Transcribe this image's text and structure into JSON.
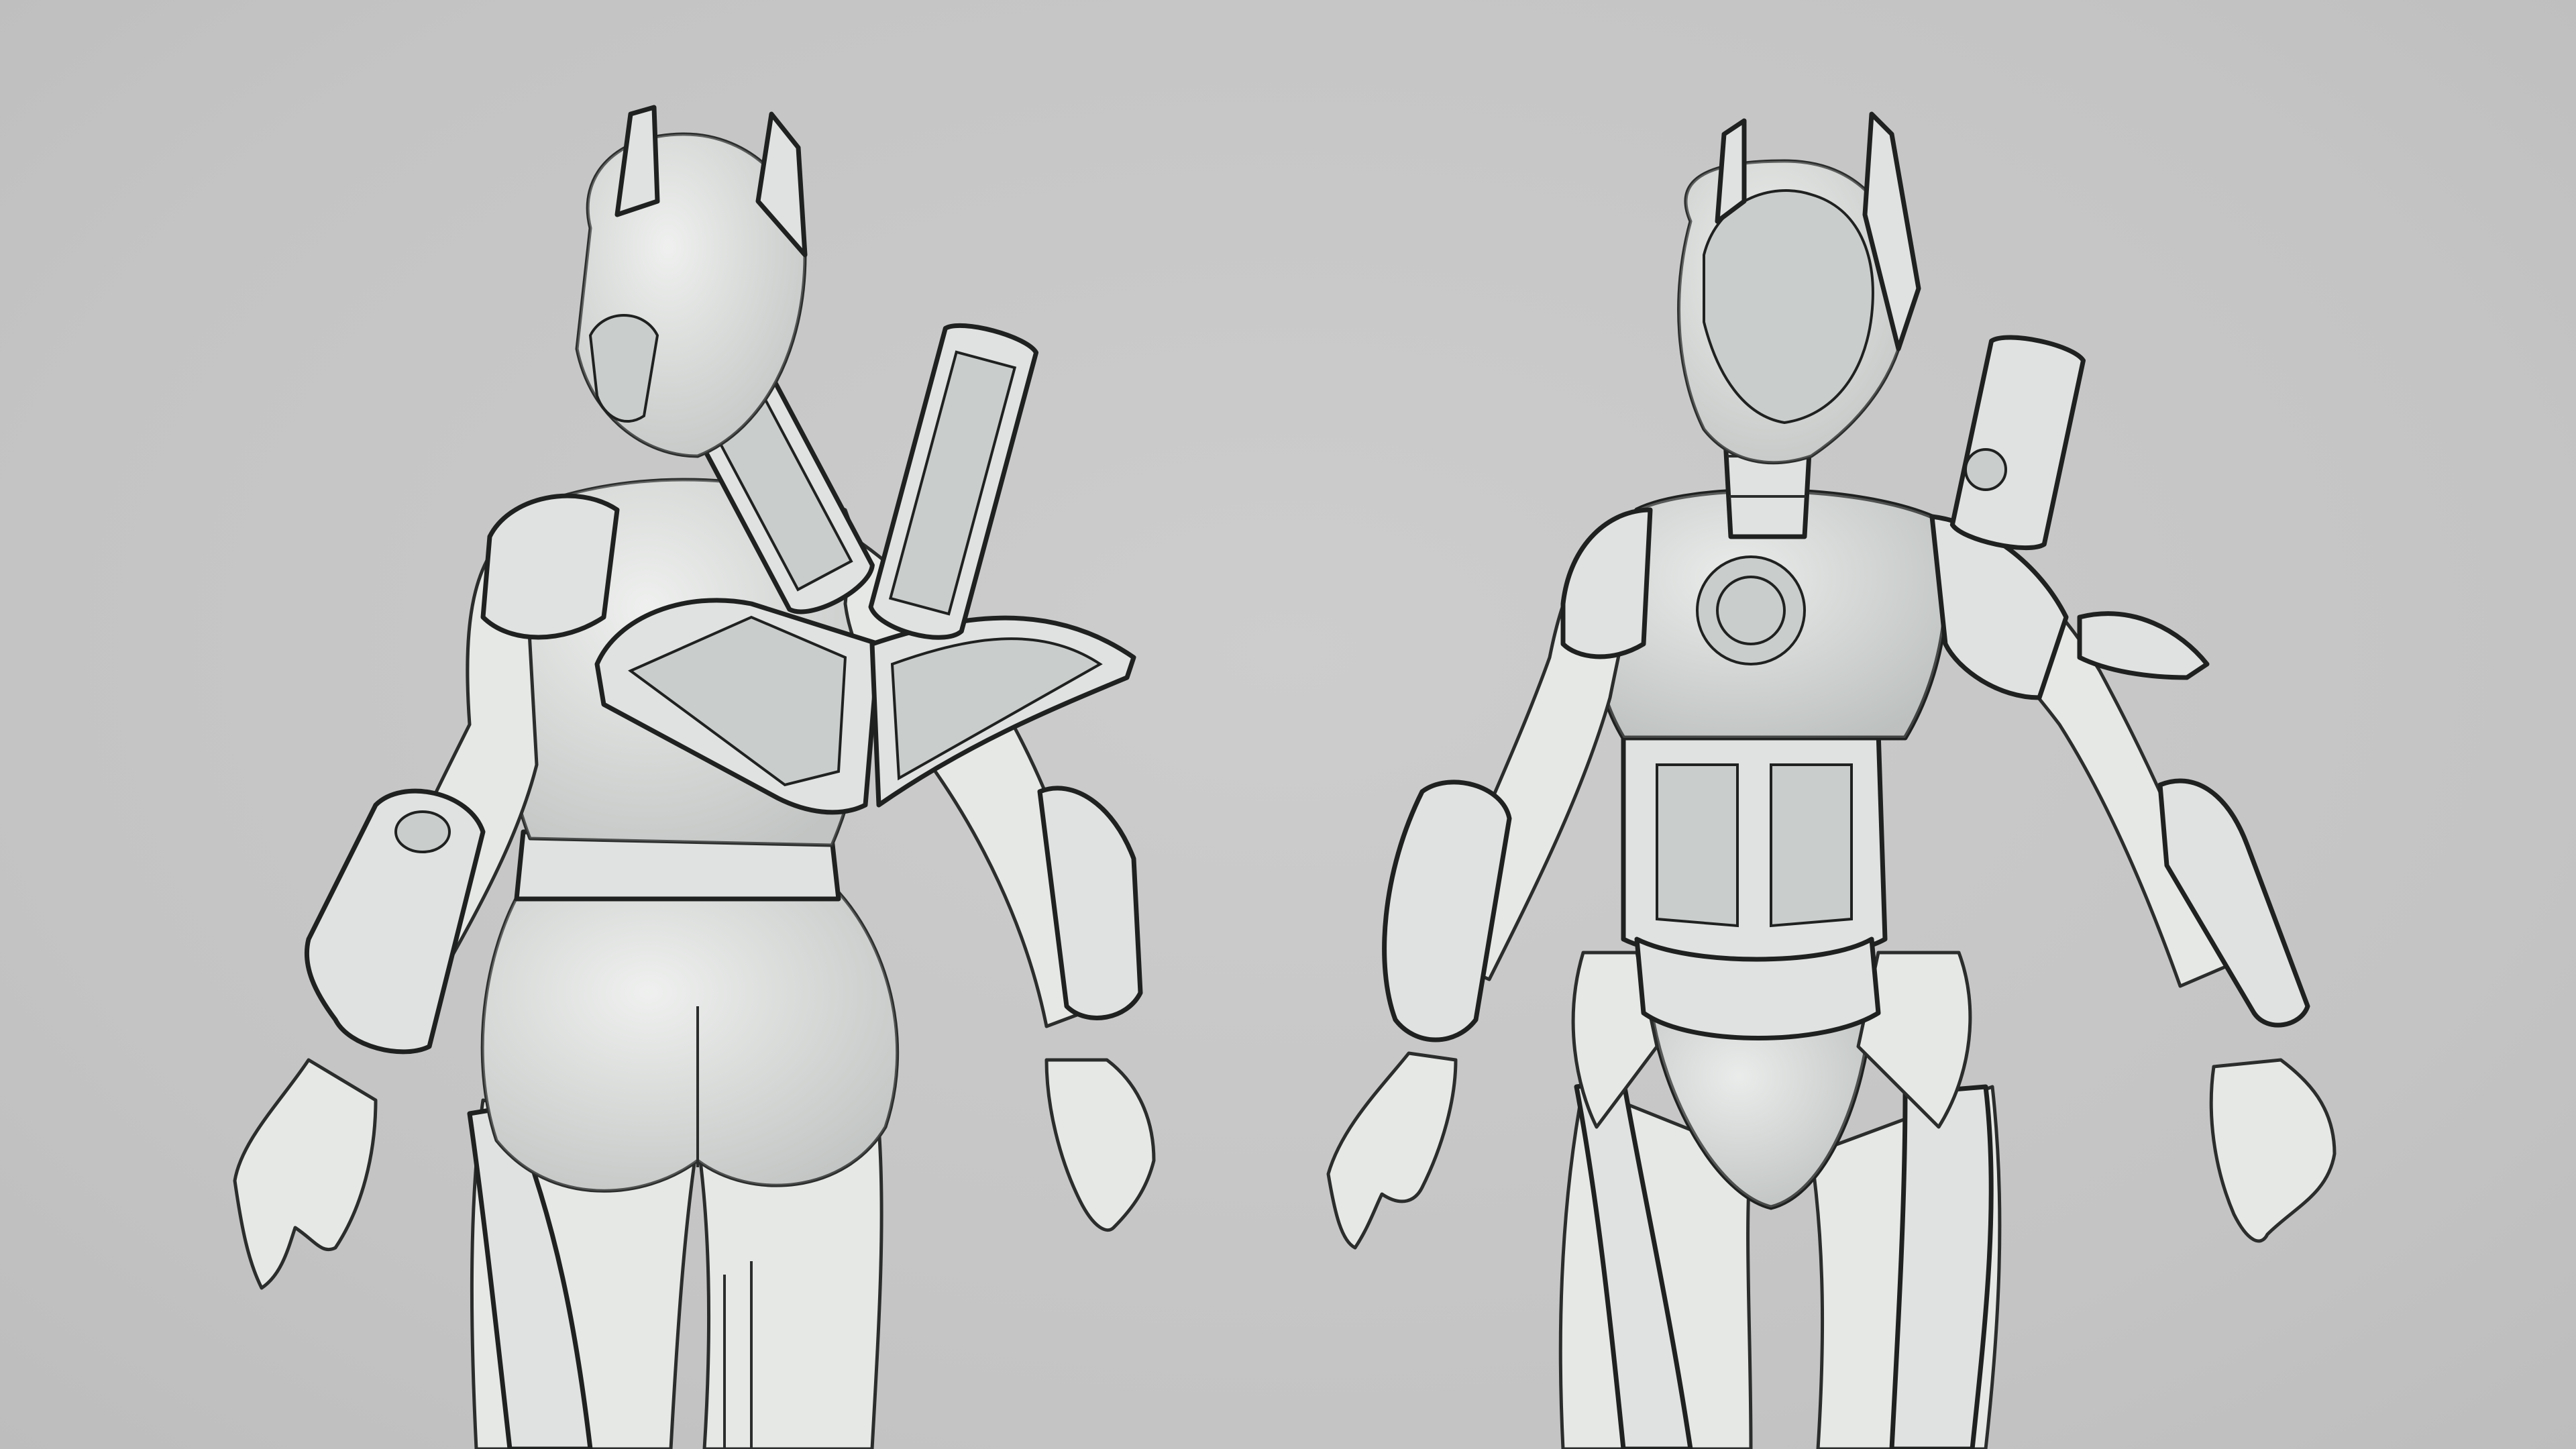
{
  "scene": {
    "background_color": "#c6c6c6",
    "mesh_fill": "#e6e8e6",
    "wire_color": "#2b2d2c"
  }
}
